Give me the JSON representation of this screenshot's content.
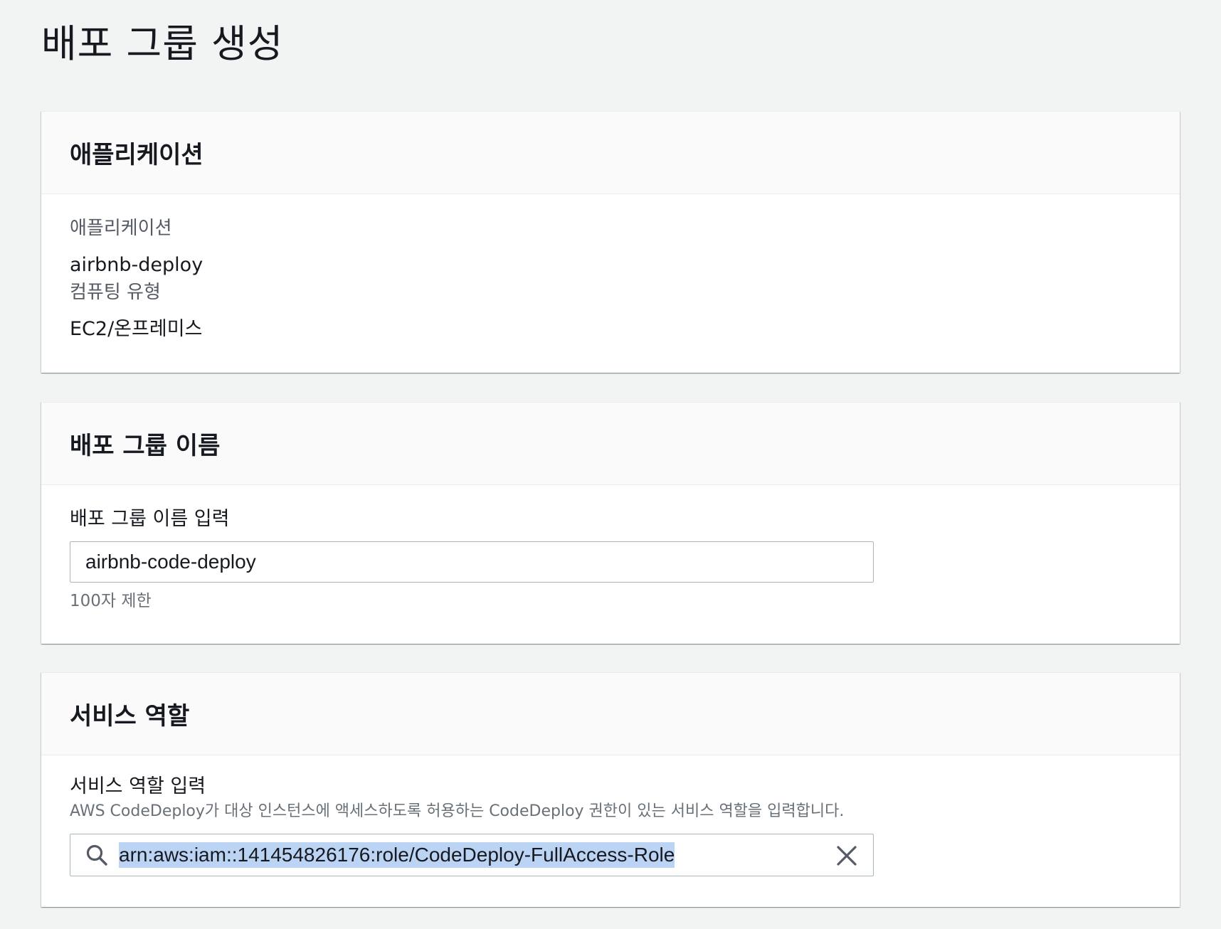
{
  "page": {
    "title": "배포 그룹 생성"
  },
  "application_panel": {
    "header": "애플리케이션",
    "application_label": "애플리케이션",
    "application_value": "airbnb-deploy",
    "compute_type_label": "컴퓨팅 유형",
    "compute_type_value": "EC2/온프레미스"
  },
  "deployment_group_name_panel": {
    "header": "배포 그룹 이름",
    "field_label": "배포 그룹 이름 입력",
    "field_value": "airbnb-code-deploy",
    "constraint": "100자 제한"
  },
  "service_role_panel": {
    "header": "서비스 역할",
    "field_label": "서비스 역할 입력",
    "field_description": "AWS CodeDeploy가 대상 인스턴스에 액세스하도록 허용하는 CodeDeploy 권한이 있는 서비스 역할을 입력합니다.",
    "field_value": "arn:aws:iam::141454826176:role/CodeDeploy-FullAccess-Role",
    "search_icon": "search-icon",
    "clear_icon": "close-icon"
  }
}
